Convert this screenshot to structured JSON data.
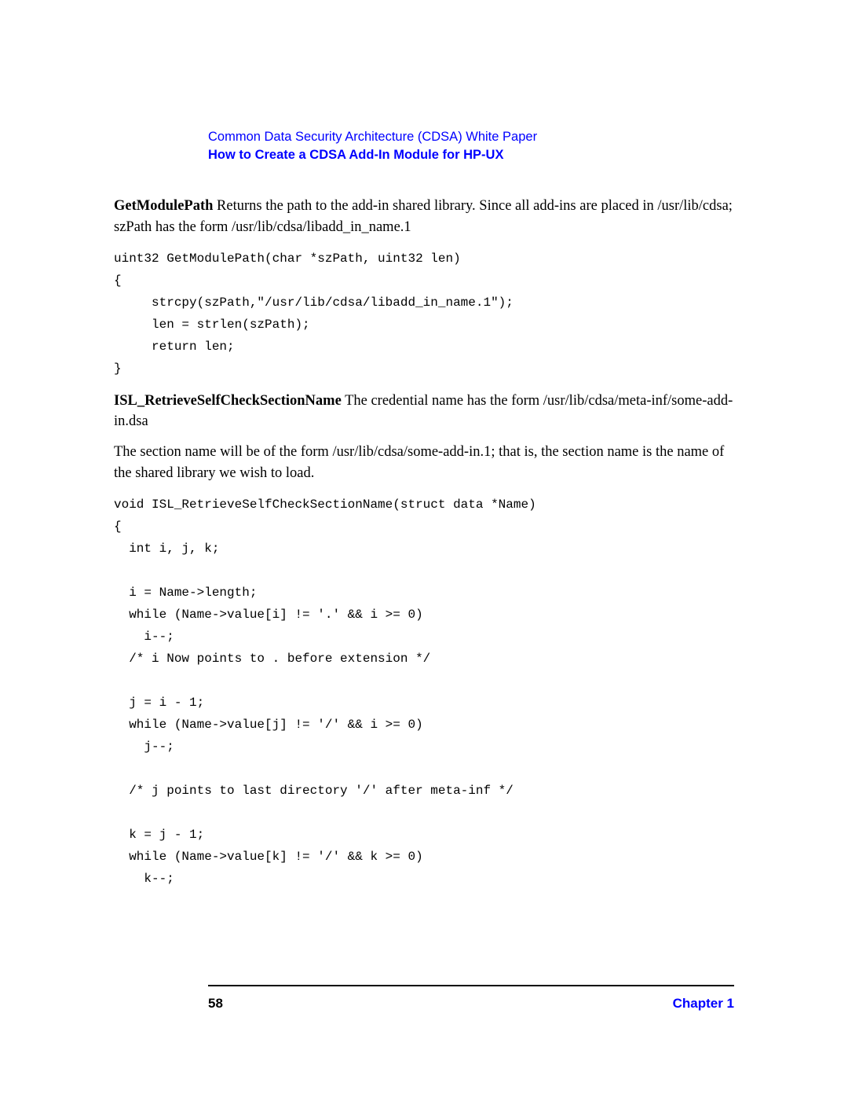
{
  "header": {
    "line1": "Common Data Security Architecture (CDSA) White Paper",
    "line2": "How to Create a CDSA Add-In Module for HP-UX"
  },
  "body": {
    "p1_bold": "GetModulePath",
    "p1_rest": "   Returns the path to the add-in shared library.  Since all add-ins are placed in /usr/lib/cdsa; szPath has the form /usr/lib/cdsa/libadd_in_name.1",
    "code1": "uint32 GetModulePath(char *szPath, uint32 len)\n{\n     strcpy(szPath,\"/usr/lib/cdsa/libadd_in_name.1\");\n     len = strlen(szPath);\n     return len;\n}",
    "p2_bold": "ISL_RetrieveSelfCheckSectionName",
    "p2_rest": "   The credential name has the form /usr/lib/cdsa/meta-inf/some-add-in.dsa",
    "p3": "The section name will be of the form /usr/lib/cdsa/some-add-in.1; that is, the section name is the name of the shared library we wish to load.",
    "code2": "void ISL_RetrieveSelfCheckSectionName(struct data *Name)\n{\n  int i, j, k;\n\n  i = Name->length;\n  while (Name->value[i] != '.' && i >= 0)\n    i--;\n  /* i Now points to . before extension */\n\n  j = i - 1;\n  while (Name->value[j] != '/' && i >= 0)\n    j--;\n\n  /* j points to last directory '/' after meta-inf */\n\n  k = j - 1;\n  while (Name->value[k] != '/' && k >= 0)\n    k--;"
  },
  "footer": {
    "page_number": "58",
    "chapter": "Chapter 1"
  }
}
